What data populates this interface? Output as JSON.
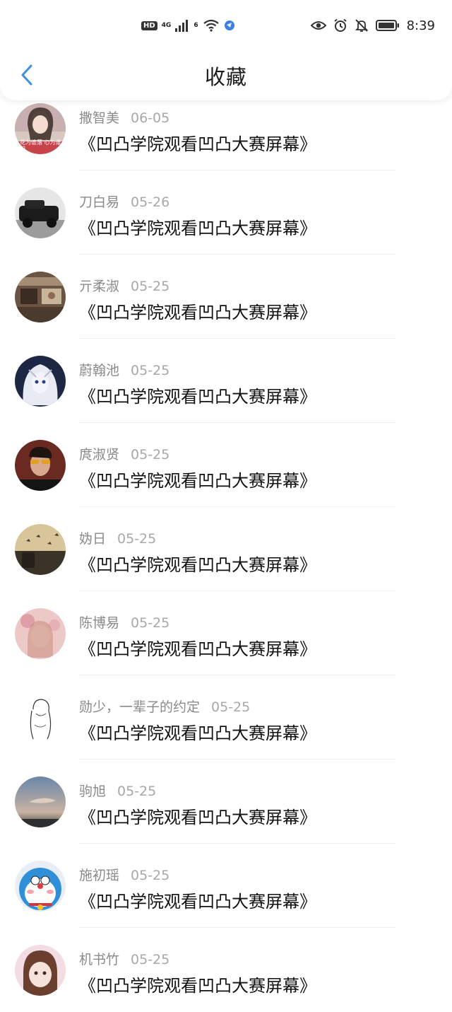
{
  "status_bar": {
    "hd": "HD",
    "network": "4G",
    "wifi_sub": "6",
    "time": "8:39",
    "icons": [
      "eye-icon",
      "alarm-icon",
      "bell-off-icon",
      "battery-icon"
    ]
  },
  "header": {
    "title": "收藏",
    "back_icon": "chevron-left-icon"
  },
  "colors": {
    "accent": "#3d8fe0",
    "name_gray": "#8a8a8a",
    "text_dark": "#111111"
  },
  "favorites": [
    {
      "name": "撒智美",
      "date": "06-05",
      "content": "《凹凸学院观看凹凸大赛屏幕》",
      "avatar_overlay": "花为谁落 心为谁归"
    },
    {
      "name": "刀白易",
      "date": "05-26",
      "content": "《凹凸学院观看凹凸大赛屏幕》"
    },
    {
      "name": "亓柔淑",
      "date": "05-25",
      "content": "《凹凸学院观看凹凸大赛屏幕》"
    },
    {
      "name": "蔚翰池",
      "date": "05-25",
      "content": "《凹凸学院观看凹凸大赛屏幕》"
    },
    {
      "name": "庹淑贤",
      "date": "05-25",
      "content": "《凹凸学院观看凹凸大赛屏幕》"
    },
    {
      "name": "妫日",
      "date": "05-25",
      "content": "《凹凸学院观看凹凸大赛屏幕》"
    },
    {
      "name": "陈博易",
      "date": "05-25",
      "content": "《凹凸学院观看凹凸大赛屏幕》"
    },
    {
      "name": "勋少，一辈子的约定",
      "date": "05-25",
      "content": "《凹凸学院观看凹凸大赛屏幕》"
    },
    {
      "name": "驹旭",
      "date": "05-25",
      "content": "《凹凸学院观看凹凸大赛屏幕》"
    },
    {
      "name": "施初瑶",
      "date": "05-25",
      "content": "《凹凸学院观看凹凸大赛屏幕》"
    },
    {
      "name": "机书竹",
      "date": "05-25",
      "content": "《凹凸学院观看凹凸大赛屏幕》"
    }
  ]
}
